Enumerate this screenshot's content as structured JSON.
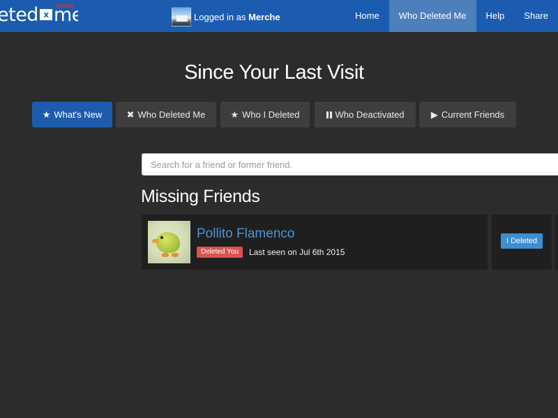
{
  "app": {
    "logo_text_left": "eted",
    "logo_text_right": "me",
    "logo_x": "x",
    "logo_badge": "(beta)",
    "user": {
      "prefix": "Logged in as ",
      "name": "Merche"
    }
  },
  "nav": {
    "items": [
      {
        "label": "Home",
        "active": false
      },
      {
        "label": "Who Deleted Me",
        "active": true
      },
      {
        "label": "Help",
        "active": false
      },
      {
        "label": "Share",
        "active": false
      }
    ]
  },
  "page": {
    "title": "Since Your Last Visit"
  },
  "tabs": [
    {
      "label": "What's New",
      "icon": "star-icon",
      "glyph": "★",
      "active": true
    },
    {
      "label": "Who Deleted Me",
      "icon": "cross-icon",
      "glyph": "✖",
      "active": false
    },
    {
      "label": "Who I Deleted",
      "icon": "star-icon",
      "glyph": "★",
      "active": false
    },
    {
      "label": "Who Deactivated",
      "icon": "pause-icon",
      "glyph": "",
      "active": false
    },
    {
      "label": "Current Friends",
      "icon": "play-icon",
      "glyph": "▶",
      "active": false
    }
  ],
  "search": {
    "placeholder": "Search for a friend or former friend.",
    "value": ""
  },
  "section": {
    "title": "Missing Friends"
  },
  "friends": [
    {
      "name": "Pollito Flamenco",
      "badge": "Deleted You",
      "last_seen": "Last seen on Jul 6th 2015",
      "action_label": "I Deleted"
    }
  ],
  "colors": {
    "navbar": "#1c5cb0",
    "nav_active": "#4d7fbd",
    "background": "#2c2c2c",
    "tab_active": "#1d5cad",
    "badge_red": "#d9534f",
    "friend_link": "#4f92d6",
    "action_blue": "#3c8fd0"
  }
}
